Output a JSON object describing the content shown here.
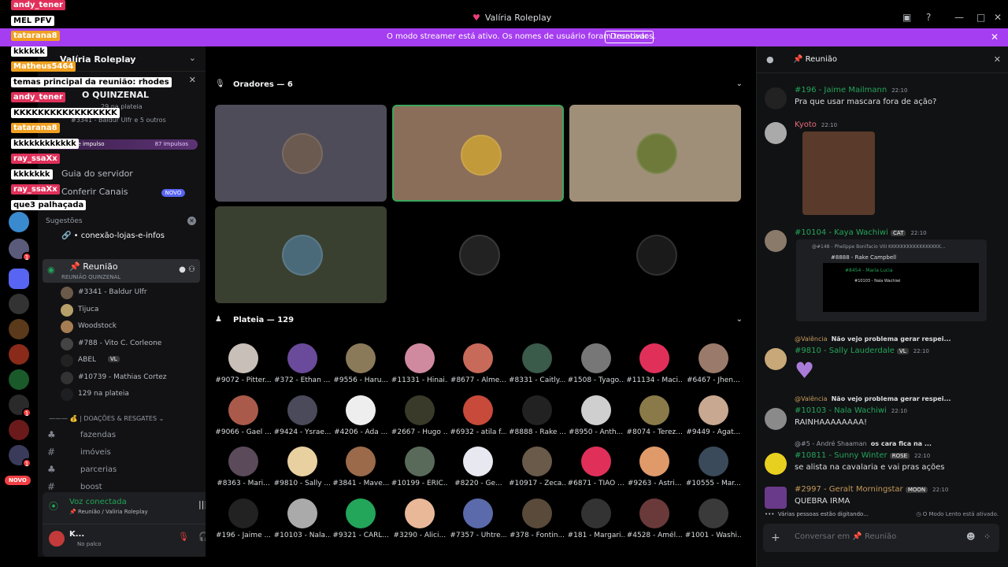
{
  "window": {
    "title": "Valíria Roleplay"
  },
  "streamer_banner": {
    "message": "O modo streamer está ativo. Os nomes de usuário foram truncados.",
    "button": "Desativar"
  },
  "guild": {
    "name": "Valíria Roleplay"
  },
  "event": {
    "title": "O QUINZENAL",
    "subtitle": "29 na plateia",
    "attendees": "#3341 - Baldur Ulfr e 5 outros"
  },
  "boost": {
    "label": "de impulso",
    "count": "87 Impulsos"
  },
  "nav": {
    "guide": "Guia do servidor",
    "browse": "Conferir Canais",
    "new_badge": "NOVO"
  },
  "suggestions": {
    "label": "Sugestões",
    "channel": "conexão-lojas-e-infos"
  },
  "voice_channel": {
    "name": "Reunião",
    "sub": "REUNIÃO QUINZENAL"
  },
  "voice_users": [
    {
      "name": "#3341 - Baldur Ulfr",
      "color": "#6b5a4a"
    },
    {
      "name": "Tijuca",
      "color": "#b7a06a"
    },
    {
      "name": "Woodstock",
      "color": "#a67c52"
    },
    {
      "name": "#788 - Vito C. Corleone",
      "color": "#444"
    },
    {
      "name": "ABEL",
      "badge": "VL",
      "color": "#222"
    },
    {
      "name": "#10739 - Mathias Cortez",
      "color": "#333"
    },
    {
      "name": "129 na plateia",
      "color": "#1e1f22"
    }
  ],
  "category": "| DOAÇÕES & RESGATES",
  "text_channels": [
    "fazendas",
    "imóveis",
    "parcerias",
    "boost"
  ],
  "user_panel": {
    "status": "Voz conectada",
    "location": "Reunião / Valíria Roleplay",
    "name": "K...",
    "sub": "No palco"
  },
  "server_badges": {
    "novo": "NOVO"
  },
  "stage": {
    "speakers_title": "Oradores — 6",
    "audience_title": "Plateia — 129",
    "speakers": [
      {
        "bg": "#4f4c59",
        "av": "#6a5a50",
        "active": false
      },
      {
        "bg": "#8a6e59",
        "av": "#c39a3a",
        "active": true
      },
      {
        "bg": "#a08f78",
        "av": "#6d7a3a",
        "active": false
      },
      {
        "bg": "#3a4030",
        "av": "#4a6a7a",
        "active": false
      },
      {
        "bg": "#000000",
        "av": "#222222",
        "active": false
      },
      {
        "bg": "#000000",
        "av": "#1a1a1a",
        "active": false
      }
    ],
    "audience": [
      [
        "#9072 - Pitter...",
        "#372 - Ethan ...",
        "#9556 - Haru...",
        "#11331 - Hinai...",
        "#8677 - Alme...",
        "#8331 - Caitly...",
        "#1508 - Tyago...",
        "#11134 - Maci...",
        "#6467 - Jhen..."
      ],
      [
        "#9066 - Gael ...",
        "#9424 - Ysrae...",
        "#4206 - Ada ...",
        "#2667 - Hugo ...",
        "#6932 - atila f...",
        "#8888 - Rake ...",
        "#8950 - Anth...",
        "#8074 - Terez...",
        "#9449 - Agat..."
      ],
      [
        "#8363 - Mari...",
        "#9810 - Sally ...",
        "#3841 - Mave...",
        "#10199 - ERIC...",
        "#8220 - Ge...",
        "#10917 - Zeca...",
        "#6871 - TIAO ...",
        "#9263 - Astri...",
        "#10555 - Mar..."
      ],
      [
        "#196 - Jaime ...",
        "#10103 - Nala...",
        "#9321 - CARL...",
        "#3290 - Alici...",
        "#7357 - Uhtre...",
        "#378 - Fontin...",
        "#181 - Margari...",
        "#4528 - Amél...",
        "#1001 - Washi..."
      ]
    ],
    "audience_colors": [
      [
        "#c8c0b8",
        "#6a4a9a",
        "#8a7a5a",
        "#d08aa0",
        "#c86a5a",
        "#3a5a4a",
        "#777777",
        "#e0305a",
        "#9a7a6a"
      ],
      [
        "#aa5a4a",
        "#4a4a5a",
        "#eeeeee",
        "#3a3a2a",
        "#c84a3a",
        "#222222",
        "#cfcfcf",
        "#8a7a4a",
        "#c8a890"
      ],
      [
        "#5a4a5a",
        "#e8d0a0",
        "#9a6a4a",
        "#5a6a5a",
        "#e8e8f0",
        "#6a5a4a",
        "#e0305a",
        "#e09a6a",
        "#3a4a5a"
      ],
      [
        "#222222",
        "#aaaaaa",
        "#23a55a",
        "#e8b898",
        "#5a6aaa",
        "#5a4a3a",
        "#333333",
        "#6a3a3a",
        "#3a3a3a"
      ]
    ]
  },
  "chat": {
    "title": "Reunião",
    "messages": [
      {
        "user": "#196 - Jaime Mailmann",
        "time": "22:10",
        "text": "Pra que usar mascara fora de ação?",
        "color": "#23a55a"
      },
      {
        "user": "Kyoto",
        "time": "22:10",
        "text": "",
        "color": "#e86a7a"
      },
      {
        "user": "#10104 - Kaya Wachiwi",
        "time": "22:10",
        "text": "",
        "badge": "CAT",
        "color": "#23a55a"
      },
      {
        "user": "#9810 - Sally Lauderdale",
        "time": "22:10",
        "text": "",
        "badge": "VL",
        "color": "#23a55a"
      },
      {
        "user": "#10103 - Nala Wachiwi",
        "time": "22:10",
        "text": "RAINHAAAAAAAA!",
        "color": "#23a55a"
      },
      {
        "user": "#10811 - Sunny Winter",
        "time": "22:10",
        "text": "se alista na cavalaria e vai pras ações",
        "badge": "ROSE",
        "color": "#23a55a"
      },
      {
        "user": "#2997 - Geralt Morningstar",
        "time": "22:10",
        "text": "QUEBRA IRMA",
        "badge": "MOON",
        "color": "#23a55a"
      }
    ],
    "replies": [
      {
        "who": "@Valência",
        "text": "Não vejo problema gerar respei..."
      },
      {
        "who": "@Valência",
        "text": "Não vejo problema gerar respei..."
      },
      {
        "who": "@#5 - André Shaaman",
        "text": "os cara fica na ..."
      }
    ],
    "embed": {
      "line1": "@#148 - Phelippe Bonifacio VIII KKKKKKKKKKKKKKKKK...",
      "line2": "#8888 - Rake Campbell",
      "line3": "#8454 - Maria Lucia",
      "line4": "#10103 - Nala Wachiwi"
    },
    "typing": "Várias pessoas estão digitando...",
    "slow_mode": "O Modo Lento está ativado.",
    "placeholder": "Conversar em 📌 Reunião"
  },
  "overlay": [
    {
      "type": "name",
      "text": "andy_tener",
      "color": "#e0305a"
    },
    {
      "type": "text",
      "text": "MEL PFV"
    },
    {
      "type": "name",
      "text": "tatarana8",
      "color": "#f0a020"
    },
    {
      "type": "text",
      "text": "kkkkkk"
    },
    {
      "type": "name",
      "text": "Matheus5464",
      "color": "#f0a020"
    },
    {
      "type": "text",
      "text": "temas principal da reunião: rhodes"
    },
    {
      "type": "name",
      "text": "andy_tener",
      "color": "#e0305a"
    },
    {
      "type": "text",
      "text": "KKKKKKKKKKKKKKKKK"
    },
    {
      "type": "name",
      "text": "tatarana8",
      "color": "#f0a020"
    },
    {
      "type": "text",
      "text": "kkkkkkkkkkkk"
    },
    {
      "type": "name",
      "text": "ray_ssaXx",
      "color": "#e0305a"
    },
    {
      "type": "text",
      "text": "kkkkkkk"
    },
    {
      "type": "name",
      "text": "ray_ssaXx",
      "color": "#e0305a"
    },
    {
      "type": "text",
      "text": "que3 palhaçada"
    }
  ]
}
